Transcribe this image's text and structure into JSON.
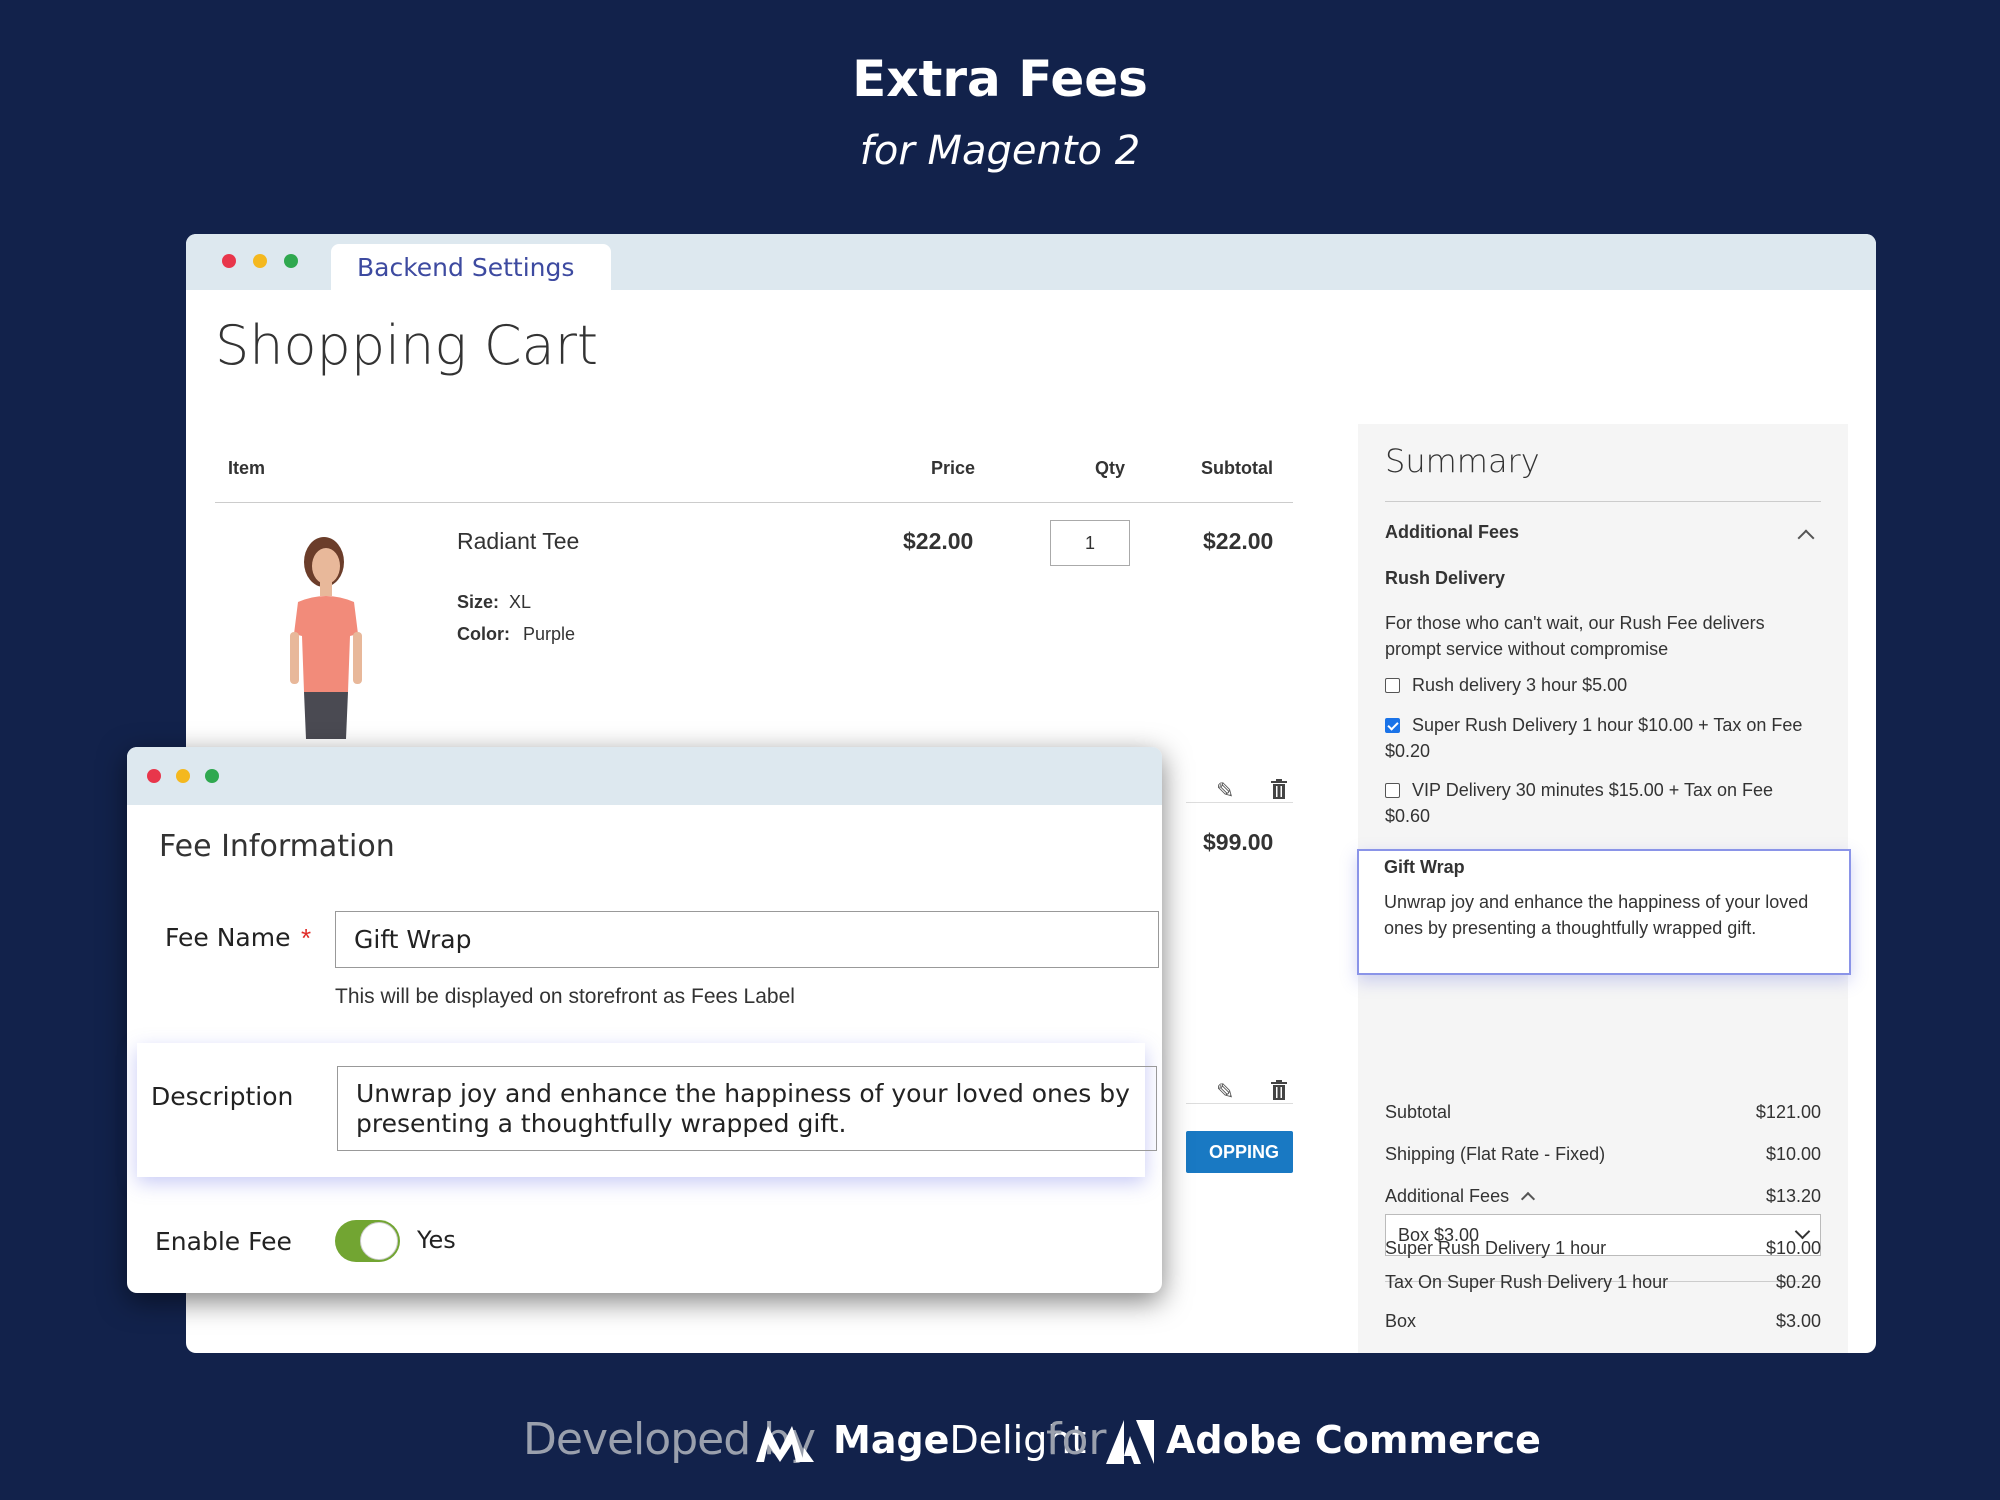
{
  "hero": {
    "title": "Extra Fees",
    "subtitle": "for Magento 2"
  },
  "backend_tab": "Backend Settings",
  "page_title": "Shopping Cart",
  "cart": {
    "columns": {
      "item": "Item",
      "price": "Price",
      "qty": "Qty",
      "subtotal": "Subtotal"
    },
    "product": {
      "name": "Radiant Tee",
      "size_label": "Size:",
      "size_value": "XL",
      "color_label": "Color:",
      "color_value": "Purple",
      "price": "$22.00",
      "qty": "1",
      "subtotal": "$22.00"
    },
    "second_subtotal": "$99.00",
    "button_label": "OPPING CART"
  },
  "summary": {
    "title": "Summary",
    "section": "Additional Fees",
    "rush": {
      "title": "Rush Delivery",
      "description": "For those who can't wait, our Rush Fee delivers prompt service without compromise",
      "options": [
        {
          "label": "Rush delivery 3 hour $5.00",
          "checked": false
        },
        {
          "label": "Super Rush Delivery 1 hour $10.00 + Tax on Fee $0.20",
          "checked": true
        },
        {
          "label": "VIP Delivery 30 minutes $15.00 + Tax on Fee $0.60",
          "checked": false
        }
      ]
    },
    "gift": {
      "title": "Gift Wrap",
      "description": "Unwrap joy and enhance the happiness of your loved ones by presenting a thoughtfully wrapped gift.",
      "selected": "Box $3.00"
    },
    "totals": [
      {
        "label": "Subtotal",
        "value": "$121.00"
      },
      {
        "label": "Shipping (Flat Rate - Fixed)",
        "value": "$10.00"
      },
      {
        "label": "Additional Fees",
        "value": "$13.20"
      },
      {
        "label": "Super Rush Delivery 1 hour",
        "value": "$10.00"
      },
      {
        "label": "Tax On Super Rush Delivery 1 hour",
        "value": "$0.20"
      },
      {
        "label": "Box",
        "value": "$3.00"
      }
    ]
  },
  "fee_form": {
    "heading": "Fee Information",
    "name_label": "Fee Name",
    "required_mark": "*",
    "name_value": "Gift Wrap",
    "name_note": "This will be displayed on storefront as Fees Label",
    "desc_label": "Description",
    "desc_value": "Unwrap joy and enhance the happiness of your loved ones by presenting a thoughtfully wrapped gift.",
    "enable_label": "Enable Fee",
    "enable_value": "Yes",
    "enabled": true
  },
  "footer": {
    "developed_by": "Developed by",
    "brand_bold": "Mage",
    "brand_light": "Delight",
    "for": "for",
    "platform": "Adobe Commerce"
  }
}
